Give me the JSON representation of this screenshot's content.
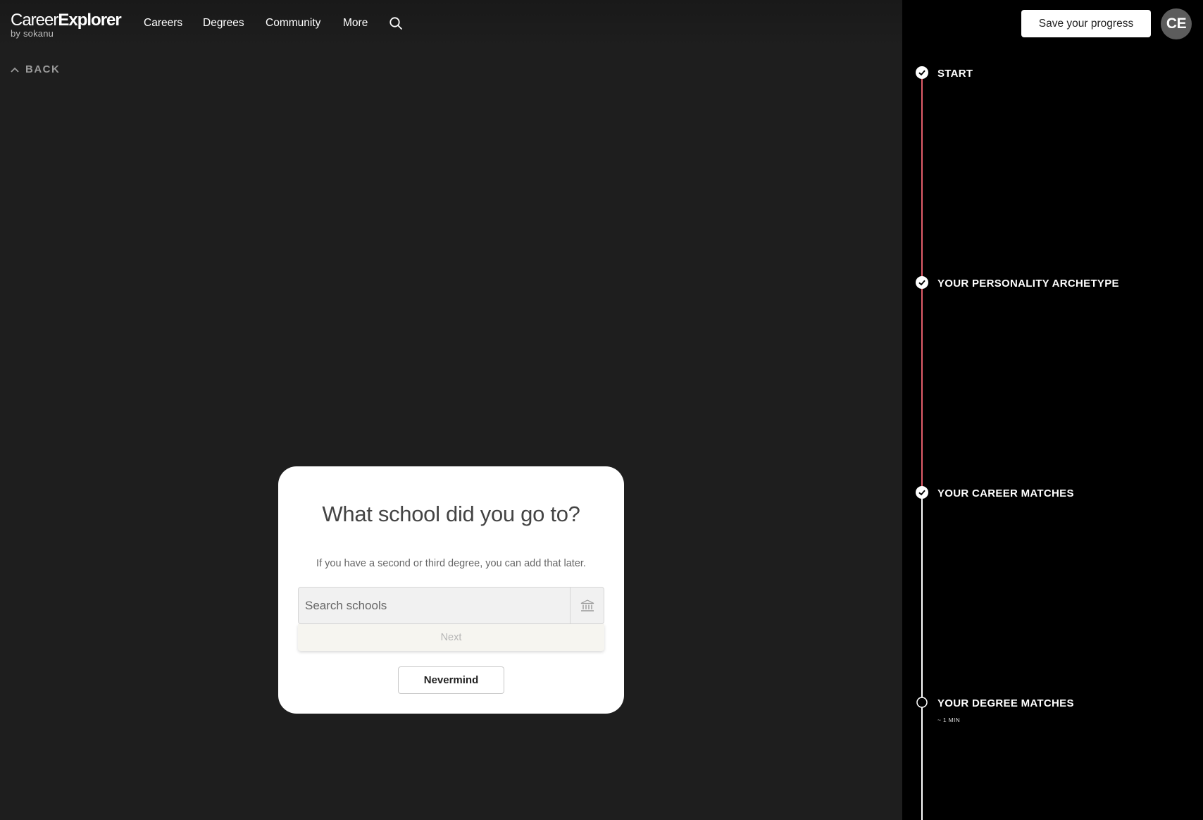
{
  "header": {
    "logo_career": "Career",
    "logo_explorer": "Explorer",
    "logo_sub": "by sokanu",
    "nav": [
      "Careers",
      "Degrees",
      "Community",
      "More"
    ],
    "search_icon": "search-icon"
  },
  "back_label": "BACK",
  "modal": {
    "title": "What school did you go to?",
    "subtitle": "If you have a second or third degree, you can add that later.",
    "search_placeholder": "Search schools",
    "search_value": "",
    "school_icon": "bank-icon",
    "next_label": "Next",
    "nevermind_label": "Nevermind"
  },
  "sidebar": {
    "save_label": "Save your progress",
    "avatar_initials": "CE",
    "steps": [
      {
        "label": "START",
        "status": "complete",
        "time": ""
      },
      {
        "label": "YOUR PERSONALITY ARCHETYPE",
        "status": "complete",
        "time": ""
      },
      {
        "label": "YOUR CAREER MATCHES",
        "status": "complete",
        "time": ""
      },
      {
        "label": "YOUR DEGREE MATCHES",
        "status": "current",
        "time": "~ 1 MIN"
      }
    ]
  },
  "colors": {
    "page_bg": "#1e1e1e",
    "sidebar_bg": "#000000",
    "progress_accent": "#e25d6a",
    "modal_bg": "#ffffff"
  }
}
